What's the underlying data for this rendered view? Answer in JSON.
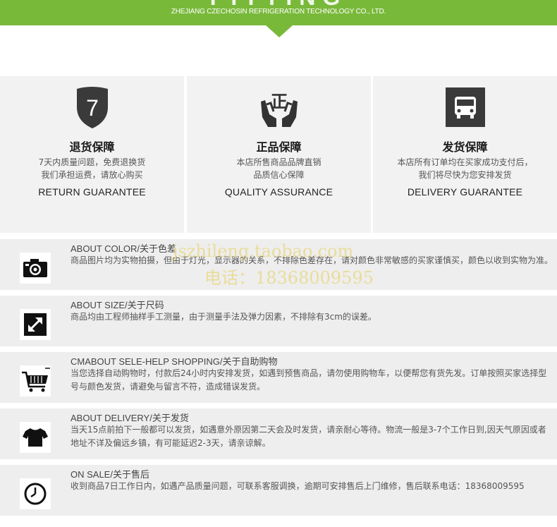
{
  "header": {
    "big_text": "FITTING",
    "company": "ZHEJIANG CZECHOSIN REFRIGERATION TECHNOLOGY CO., LTD.",
    "color": "#79b93a"
  },
  "cards": [
    {
      "icon": "seven-day-shield-icon",
      "icon_text": "7",
      "title": "退货保障",
      "line1": "7天内质量问题，免费退换货",
      "line2": "我们承担运费，请放心购买",
      "en": "RETURN GUARANTEE"
    },
    {
      "icon": "hands-genuine-icon",
      "icon_text": "正",
      "title": "正品保障",
      "line1": "本店所售商品品牌直销",
      "line2": "品质信心保障",
      "en": "QUALITY ASSURANCE"
    },
    {
      "icon": "truck-icon",
      "title": "发货保障",
      "line1": "本店所有订单均在买家成功支付后，",
      "line2": "我们将尽快为您安排发货",
      "en": "DELIVERY GUARANTEE"
    }
  ],
  "rows": [
    {
      "icon": "camera-icon",
      "title": "ABOUT COLOR/关于色差",
      "text": "商品图片均为实物拍摄，但由于灯光，显示器的关系，不排除色差存在，请对颜色非常敏感的买家谨慎买，颜色以收到实物为准。"
    },
    {
      "icon": "resize-icon",
      "title": "ABOUT SIZE/关于尺码",
      "text": "商品均由工程师抽样手工测量，由于测量手法及弹力因素，不排除有3cm的误差。"
    },
    {
      "icon": "shopping-cart-icon",
      "title": "CMABOUT SELE-HELP SHOPPING/关于自助购物",
      "text": "当您选择自动购物时，付款后24小时内安排发货，如遇到预售商品，请勿使用购物车，以便帮您有货先发。订单按照买家选择型号与颜色发货，请避免与留言不符，造成错误发货。"
    },
    {
      "icon": "tshirt-icon",
      "title": "ABOUT DELIVERY/关于发货",
      "text": "当天15点前拍下一般都可以发货，如遇意外原因第二天会及时发货，请亲耐心等待。物流一般是3-7个工作日到,因天气原因或者地址不详及偏远乡镇，有可能延迟2-3天，请亲谅解。"
    },
    {
      "icon": "clock-icon",
      "title": "ON SALE/关于售后",
      "text": "收到商品7日工作日内，如遇产品质量问题，可联系客服调换，逾期可安排售后上门维修，售后联系电话：18368009595"
    }
  ],
  "watermark": {
    "line1": "jszhileng.taobao.com",
    "line2": "电话：18368009595"
  }
}
